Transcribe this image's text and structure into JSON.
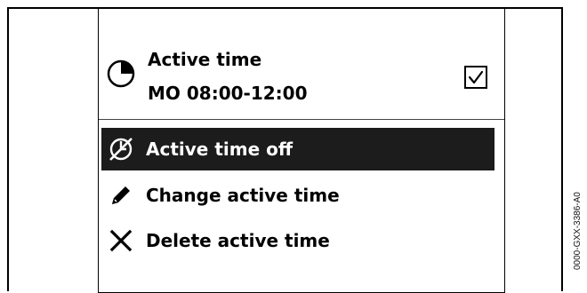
{
  "header": {
    "title": "Active time",
    "schedule": "MO 08:00-12:00",
    "icon": "clock-icon",
    "checkbox_checked": true
  },
  "menu": {
    "items": [
      {
        "label": "Active time off",
        "icon": "clock-off-icon",
        "selected": true
      },
      {
        "label": "Change active time",
        "icon": "pencil-icon",
        "selected": false
      },
      {
        "label": "Delete active time",
        "icon": "close-icon",
        "selected": false
      }
    ]
  },
  "figure_code": "0000-GXX-3386-A0",
  "colors": {
    "selected_background": "#1c1c1c",
    "selected_text": "#ffffff",
    "text": "#000000",
    "background": "#ffffff"
  }
}
